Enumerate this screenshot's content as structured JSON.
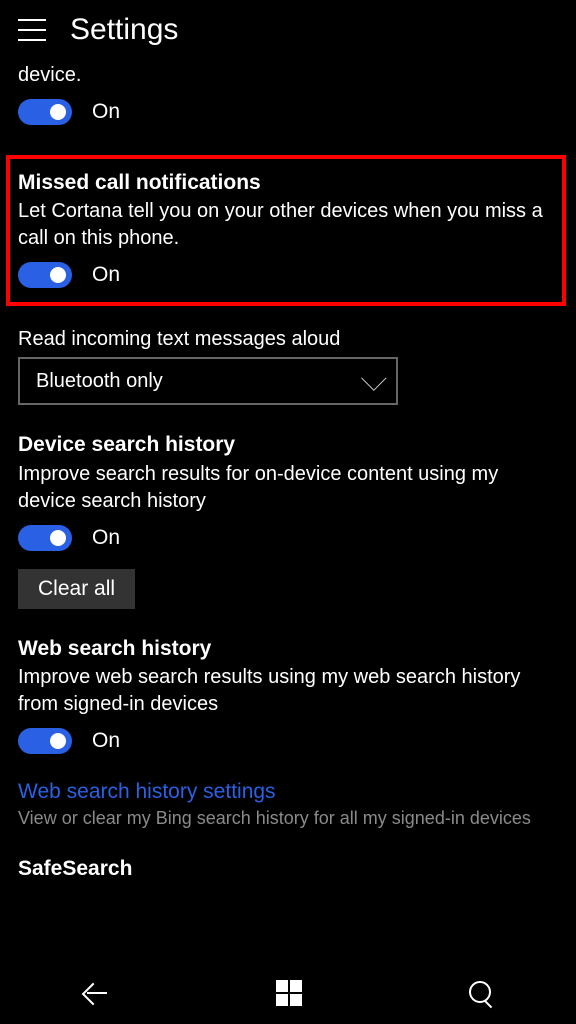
{
  "header": {
    "title": "Settings"
  },
  "partial": {
    "tail": "device.",
    "toggle": "On"
  },
  "missed": {
    "title": "Missed call notifications",
    "desc": "Let Cortana tell you on your other devices when you miss a call on this phone.",
    "toggle": "On"
  },
  "readAloud": {
    "label": "Read incoming text messages aloud",
    "value": "Bluetooth only"
  },
  "deviceHistory": {
    "title": "Device search history",
    "desc": "Improve search results for on-device content using my device search history",
    "toggle": "On",
    "clear": "Clear all"
  },
  "webHistory": {
    "title": "Web search history",
    "desc": "Improve web search results using my web search history from signed-in devices",
    "toggle": "On",
    "link": "Web search history settings",
    "linkDesc": "View or clear my Bing search history for all my signed-in devices"
  },
  "safeSearch": {
    "title": "SafeSearch"
  }
}
